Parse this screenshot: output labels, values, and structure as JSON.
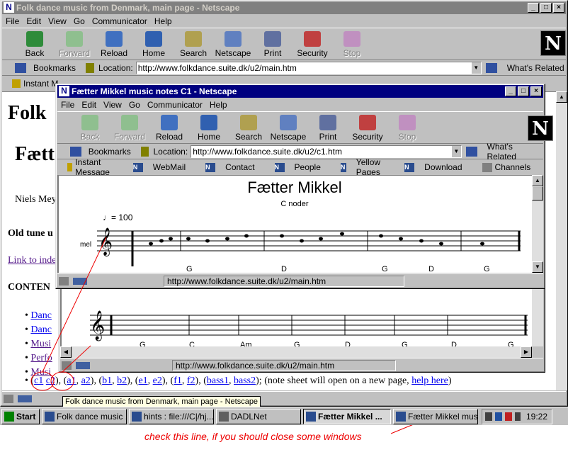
{
  "main_window": {
    "title": "Folk dance music from Denmark, main page - Netscape",
    "menu": [
      "File",
      "Edit",
      "View",
      "Go",
      "Communicator",
      "Help"
    ],
    "toolbar": [
      "Back",
      "Forward",
      "Reload",
      "Home",
      "Search",
      "Netscape",
      "Print",
      "Security",
      "Stop"
    ],
    "bookmarks_label": "Bookmarks",
    "location_label": "Location:",
    "url": "http://www.folkdance.suite.dk/u2/main.htm",
    "whats_related": "What's Related",
    "instant_message": "Instant M",
    "page": {
      "heading1": "Folk",
      "heading2": "Fætt",
      "author": "Niels Mey",
      "oldtune": "Old tune u",
      "link_index": "Link to inde",
      "contents": "CONTEN",
      "bullets": [
        "Danc",
        "Danc",
        "Musi",
        "Perfo",
        "Musi"
      ],
      "last_line_links": [
        "c1",
        "c2",
        "a1",
        "a2",
        "b1",
        "b2",
        "e1",
        "e2",
        "f1",
        "f2",
        "bass1",
        "bass2"
      ],
      "last_line_note": "(note sheet will open on a new page,",
      "help_link": "help here"
    },
    "tooltip": "Folk dance music from Denmark, main page - Netscape"
  },
  "popup1": {
    "title": "Fætter Mikkel music notes C1 - Netscape",
    "menu": [
      "File",
      "Edit",
      "View",
      "Go",
      "Communicator",
      "Help"
    ],
    "toolbar": [
      "Back",
      "Forward",
      "Reload",
      "Home",
      "Search",
      "Netscape",
      "Print",
      "Security",
      "Stop"
    ],
    "bookmarks_label": "Bookmarks",
    "location_label": "Location:",
    "url": "http://www.folkdance.suite.dk/u2/c1.htm",
    "whats_related": "What's Related",
    "personal": [
      "Instant Message",
      "WebMail",
      "Contact",
      "People",
      "Yellow Pages",
      "Download",
      "Channels"
    ],
    "sheet_title": "Fætter Mikkel",
    "sheet_subtitle": "C noder",
    "tempo": "= 100",
    "voice": "mel",
    "chords": [
      "G",
      "D",
      "G",
      "D",
      "G"
    ],
    "status_url": "http://www.folkdance.suite.dk/u2/main.htm"
  },
  "popup2": {
    "chords": [
      "G",
      "C",
      "Am",
      "G",
      "D",
      "G",
      "D",
      "G"
    ],
    "status_url": "http://www.folkdance.suite.dk/u2/main.htm"
  },
  "taskbar": {
    "start": "Start",
    "tasks": [
      "Folk dance music ...",
      "hints : file:///C|/hj...",
      "DADLNet",
      "Fætter Mikkel ...",
      "Fætter Mikkel mus..."
    ],
    "clock": "19:22"
  },
  "annotation": "check this line, if you should close some windows"
}
